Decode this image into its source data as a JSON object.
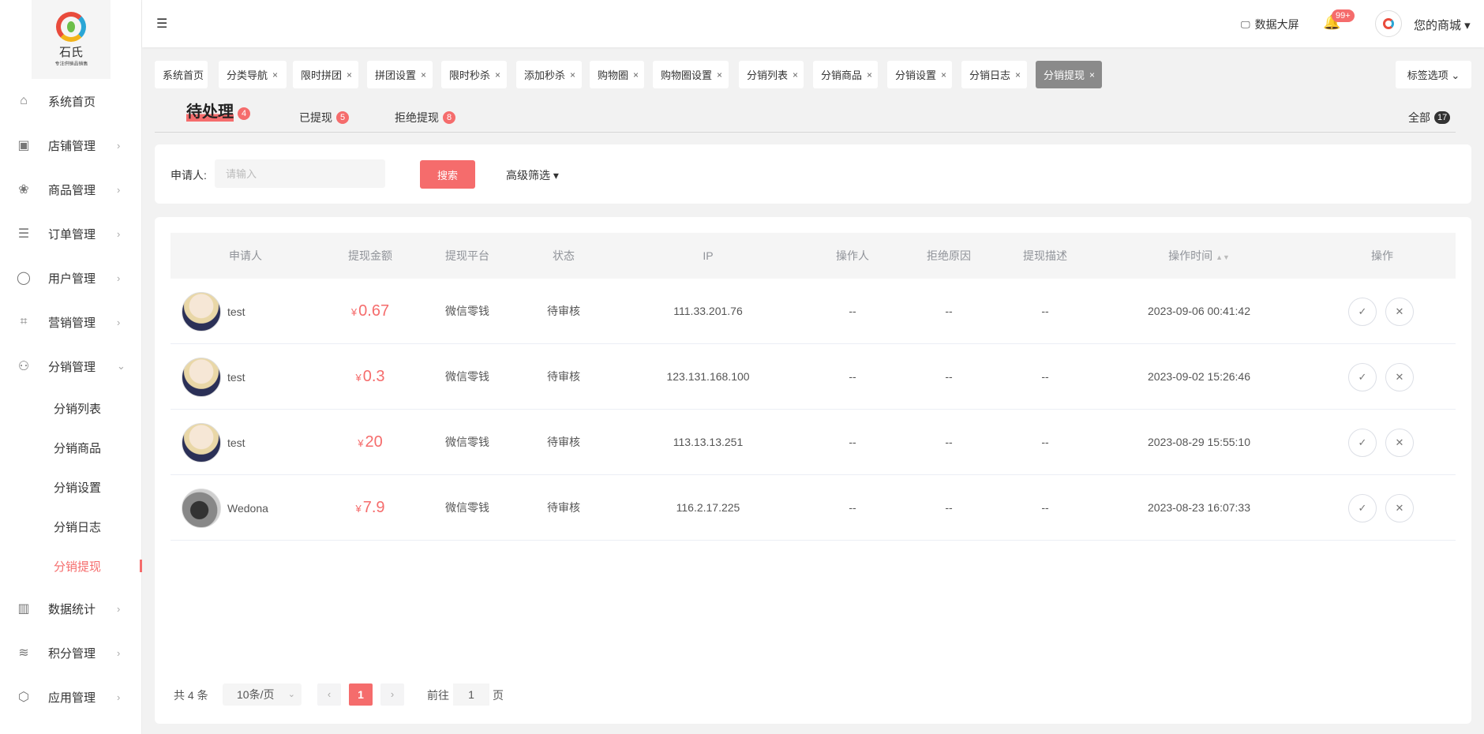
{
  "logo": {
    "name": "石氏",
    "sub": "专注供销品销售"
  },
  "sidebar": {
    "items": [
      {
        "label": "系统首页",
        "icon": "home-icon",
        "glyph": "⌂",
        "arrow": ""
      },
      {
        "label": "店铺管理",
        "icon": "store-icon",
        "glyph": "▣",
        "arrow": "›"
      },
      {
        "label": "商品管理",
        "icon": "goods-icon",
        "glyph": "❀",
        "arrow": "›"
      },
      {
        "label": "订单管理",
        "icon": "order-icon",
        "glyph": "☰",
        "arrow": "›"
      },
      {
        "label": "用户管理",
        "icon": "user-icon",
        "glyph": "◯",
        "arrow": "›"
      },
      {
        "label": "营销管理",
        "icon": "marketing-icon",
        "glyph": "⌗",
        "arrow": "›"
      },
      {
        "label": "分销管理",
        "icon": "distribution-icon",
        "glyph": "⚇",
        "arrow": "⌄"
      }
    ],
    "sub_items": [
      {
        "label": "分销列表"
      },
      {
        "label": "分销商品"
      },
      {
        "label": "分销设置"
      },
      {
        "label": "分销日志"
      },
      {
        "label": "分销提现"
      }
    ],
    "bottom_items": [
      {
        "label": "数据统计",
        "icon": "statistics-icon",
        "glyph": "▥",
        "arrow": "›"
      },
      {
        "label": "积分管理",
        "icon": "points-icon",
        "glyph": "≋",
        "arrow": "›"
      },
      {
        "label": "应用管理",
        "icon": "app-icon",
        "glyph": "⬡",
        "arrow": "›"
      }
    ]
  },
  "header": {
    "menu_glyph": "☰",
    "big_screen": "数据大屏",
    "notif_badge": "99+",
    "shop": "您的商城 ▾"
  },
  "tabs": [
    {
      "label": "系统首页",
      "close": ""
    },
    {
      "label": "分类导航",
      "close": "×"
    },
    {
      "label": "限时拼团",
      "close": "×"
    },
    {
      "label": "拼团设置",
      "close": "×"
    },
    {
      "label": "限时秒杀",
      "close": "×"
    },
    {
      "label": "添加秒杀",
      "close": "×"
    },
    {
      "label": "购物圈",
      "close": "×"
    },
    {
      "label": "购物圈设置",
      "close": "×"
    },
    {
      "label": "分销列表",
      "close": "×"
    },
    {
      "label": "分销商品",
      "close": "×"
    },
    {
      "label": "分销设置",
      "close": "×"
    },
    {
      "label": "分销日志",
      "close": "×"
    },
    {
      "label": "分销提现",
      "close": "×"
    }
  ],
  "tab_options": "标签选项 ⌄",
  "status_tabs": [
    {
      "label": "待处理",
      "count": "4"
    },
    {
      "label": "已提现",
      "count": "5"
    },
    {
      "label": "拒绝提现",
      "count": "8"
    }
  ],
  "status_all": {
    "label": "全部",
    "count": "17"
  },
  "search": {
    "label": "申请人:",
    "placeholder": "请输入",
    "button": "搜索",
    "advanced": "高级筛选 ▾"
  },
  "table": {
    "columns": [
      "申请人",
      "提现金额",
      "提现平台",
      "状态",
      "IP",
      "操作人",
      "拒绝原因",
      "提现描述",
      "操作时间",
      "操作"
    ],
    "sort_glyph": "▲▼",
    "rows": [
      {
        "user": "test",
        "currency": "¥",
        "amount": "0.67",
        "platform": "微信零钱",
        "status": "待审核",
        "ip": "111.33.201.76",
        "operator": "--",
        "reason": "--",
        "desc": "--",
        "time": "2023-09-06 00:41:42"
      },
      {
        "user": "test",
        "currency": "¥",
        "amount": "0.3",
        "platform": "微信零钱",
        "status": "待审核",
        "ip": "123.131.168.100",
        "operator": "--",
        "reason": "--",
        "desc": "--",
        "time": "2023-09-02 15:26:46"
      },
      {
        "user": "test",
        "currency": "¥",
        "amount": "20",
        "platform": "微信零钱",
        "status": "待审核",
        "ip": "113.13.13.251",
        "operator": "--",
        "reason": "--",
        "desc": "--",
        "time": "2023-08-29 15:55:10"
      },
      {
        "user": "Wedona",
        "currency": "¥",
        "amount": "7.9",
        "platform": "微信零钱",
        "status": "待审核",
        "ip": "116.2.17.225",
        "operator": "--",
        "reason": "--",
        "desc": "--",
        "time": "2023-08-23 16:07:33"
      }
    ],
    "approve_glyph": "✓",
    "reject_glyph": "✕"
  },
  "pagination": {
    "total": "共 4 条",
    "page_size": "10条/页",
    "prev": "‹",
    "next": "›",
    "current": "1",
    "goto_label": "前往",
    "goto_value": "1",
    "page_label": "页"
  },
  "colors": {
    "accent": "#f56c6c",
    "active_tab": "#8a8a8a"
  }
}
